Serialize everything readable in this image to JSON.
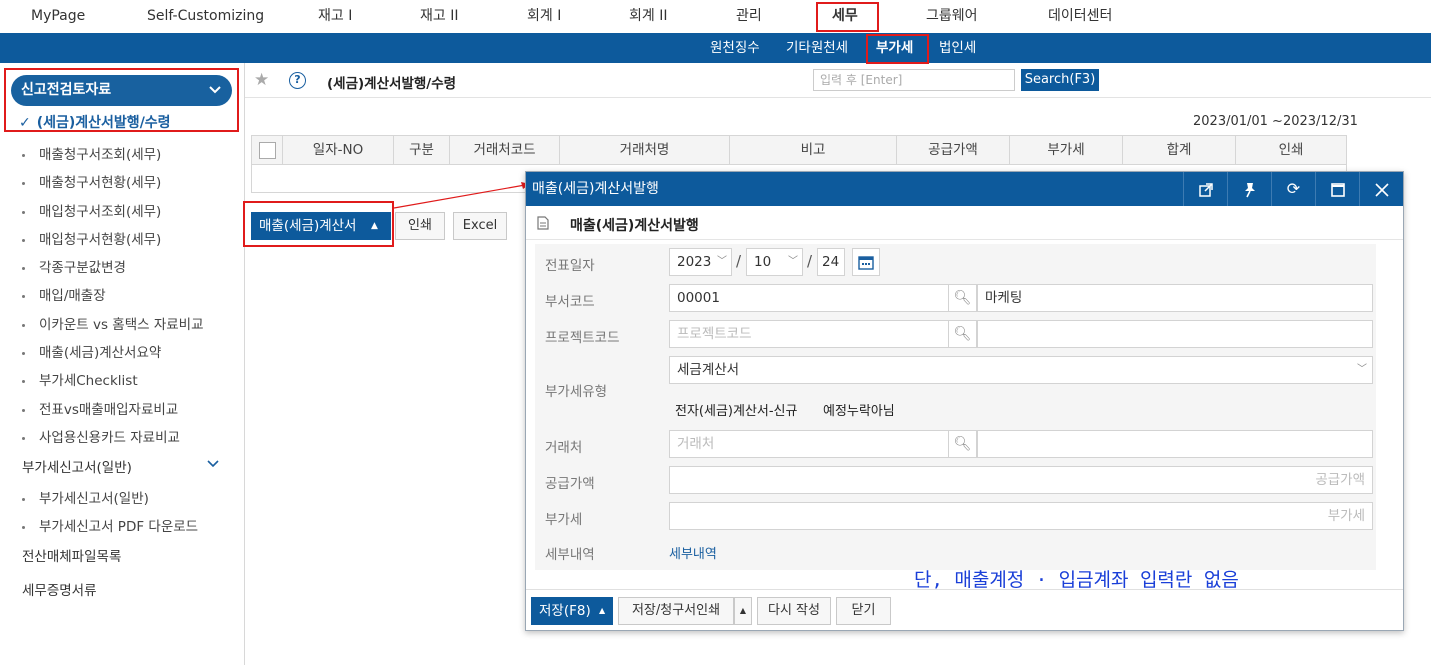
{
  "top_nav": [
    "MyPage",
    "Self-Customizing",
    "재고 I",
    "재고 II",
    "회계 I",
    "회계 II",
    "관리",
    "세무",
    "그룹웨어",
    "데이터센터"
  ],
  "sub_nav": [
    "원천징수",
    "기타원천세",
    "부가세",
    "법인세"
  ],
  "sidebar": {
    "header": "신고전검토자료",
    "selected": "(세금)계산서발행/수령",
    "items": [
      "매출청구서조회(세무)",
      "매출청구서현황(세무)",
      "매입청구서조회(세무)",
      "매입청구서현황(세무)",
      "각종구분값변경",
      "매입/매출장",
      "이카운트 vs 홈택스 자료비교",
      "매출(세금)계산서요약",
      "부가세Checklist",
      "전표vs매출매입자료비교",
      "사업용신용카드 자료비교"
    ],
    "group2": "부가세신고서(일반)",
    "group2_items": [
      "부가세신고서(일반)",
      "부가세신고서 PDF 다운로드"
    ],
    "group3": "전산매체파일목록",
    "group4": "세무증명서류"
  },
  "main": {
    "title": "(세금)계산서발행/수령",
    "search_placeholder": "입력 후 [Enter]",
    "search_button": "Search(F3)",
    "date_range": "2023/01/01 ~2023/12/31",
    "columns": [
      "일자-NO",
      "구분",
      "거래처코드",
      "거래처명",
      "비고",
      "공급가액",
      "부가세",
      "합계",
      "인쇄"
    ],
    "issue_button": "매출(세금)계산서",
    "print_button": "인쇄",
    "excel_button": "Excel"
  },
  "dialog": {
    "title": "매출(세금)계산서발행",
    "subtitle": "매출(세금)계산서발행",
    "labels": {
      "date": "전표일자",
      "dept": "부서코드",
      "project": "프로젝트코드",
      "vat_type": "부가세유형",
      "customer": "거래처",
      "supply": "공급가액",
      "vat": "부가세",
      "detail": "세부내역"
    },
    "date": {
      "year": "2023",
      "month": "10",
      "day": "24",
      "sep": "/"
    },
    "dept_code": "00001",
    "dept_name": "마케팅",
    "project_placeholder": "프로젝트코드",
    "vat_type_value": "세금계산서",
    "vat_tag1": "전자(세금)계산서-신규",
    "vat_tag2": "예정누락아님",
    "customer_placeholder": "거래처",
    "supply_placeholder": "공급가액",
    "vat_placeholder": "부가세",
    "detail_link": "세부내역",
    "annotation": "단, 매출계정 · 입금계좌 입력란 없음",
    "buttons": {
      "save": "저장(F8)",
      "save_print": "저장/청구서인쇄",
      "rewrite": "다시 작성",
      "close": "닫기"
    }
  },
  "colors": {
    "brand": "#0d5a9c",
    "highlight": "#e01b1b",
    "annotation": "#1a3fd8"
  }
}
